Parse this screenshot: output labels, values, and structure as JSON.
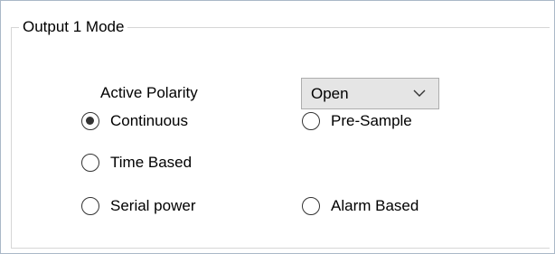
{
  "group": {
    "title": "Output 1 Mode"
  },
  "polarity": {
    "label": "Active Polarity",
    "selected": "Open"
  },
  "modes": {
    "continuous": {
      "label": "Continuous",
      "checked": true
    },
    "pre_sample": {
      "label": "Pre-Sample",
      "checked": false
    },
    "time_based": {
      "label": "Time Based",
      "checked": false
    },
    "serial_power": {
      "label": "Serial power",
      "checked": false
    },
    "alarm_based": {
      "label": "Alarm Based",
      "checked": false
    }
  },
  "icons": {
    "dropdown": "chevron-down-icon"
  },
  "colors": {
    "frame_border": "#aab8c8",
    "group_border": "#d6d6d6",
    "combo_background": "#e5e5e5",
    "combo_border": "#adadad",
    "radio": "#333333"
  }
}
